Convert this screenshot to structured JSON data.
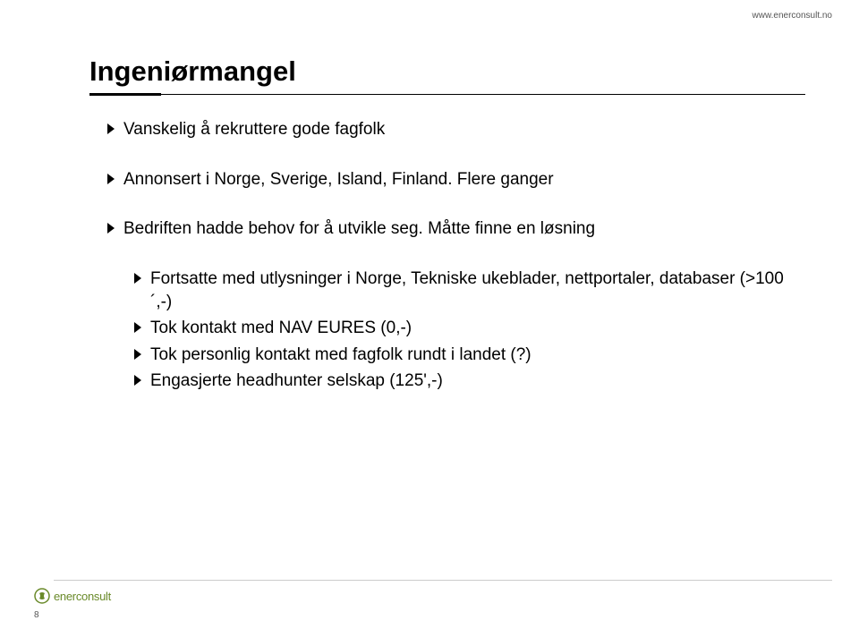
{
  "url": "www.enerconsult.no",
  "title": "Ingeniørmangel",
  "bullets_group1": [
    "Vanskelig å rekruttere gode fagfolk"
  ],
  "bullets_group2": [
    "Annonsert i Norge, Sverige, Island, Finland. Flere ganger"
  ],
  "bullets_group3": [
    "Bedriften hadde behov for å utvikle seg. Måtte finne en løsning"
  ],
  "bullets_group4": [
    "Fortsatte med utlysninger i Norge, Tekniske ukeblader, nettportaler, databaser (>100´,-)",
    "Tok kontakt med NAV EURES (0,-)",
    "Tok personlig kontakt med fagfolk rundt i landet (?)",
    "Engasjerte headhunter selskap (125',-)"
  ],
  "logo_text": "enerconsult",
  "page_number": "8"
}
